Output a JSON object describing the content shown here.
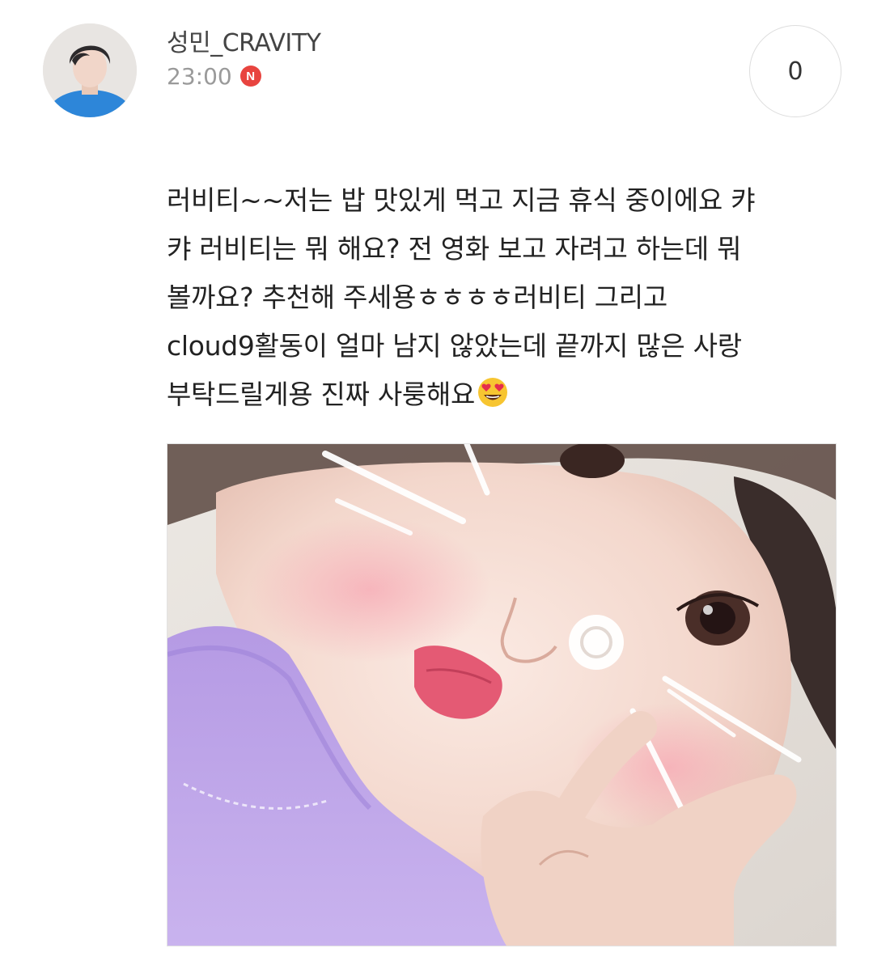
{
  "post": {
    "author": "성민_CRAVITY",
    "time": "23:00",
    "new_badge": "N",
    "count": "0",
    "message_lines": [
      "러비티~~저는 밥 맛있게 먹고 지금 휴식 중이에요 캬",
      "캬 러비티는 뭐 해요? 전 영화 보고 자려고 하는데 뭐",
      "볼까요? 추천해 주세용ㅎㅎㅎㅎ러비티 그리고",
      "cloud9활동이 얼마 남지 않았는데 끝까지 많은 사랑",
      "부탁드릴게용 진짜 사룽해요"
    ],
    "emoji": "heart-eyes-emoji"
  },
  "colors": {
    "badge_red": "#e8443f",
    "text": "#222222",
    "muted": "#9a9a9a"
  }
}
